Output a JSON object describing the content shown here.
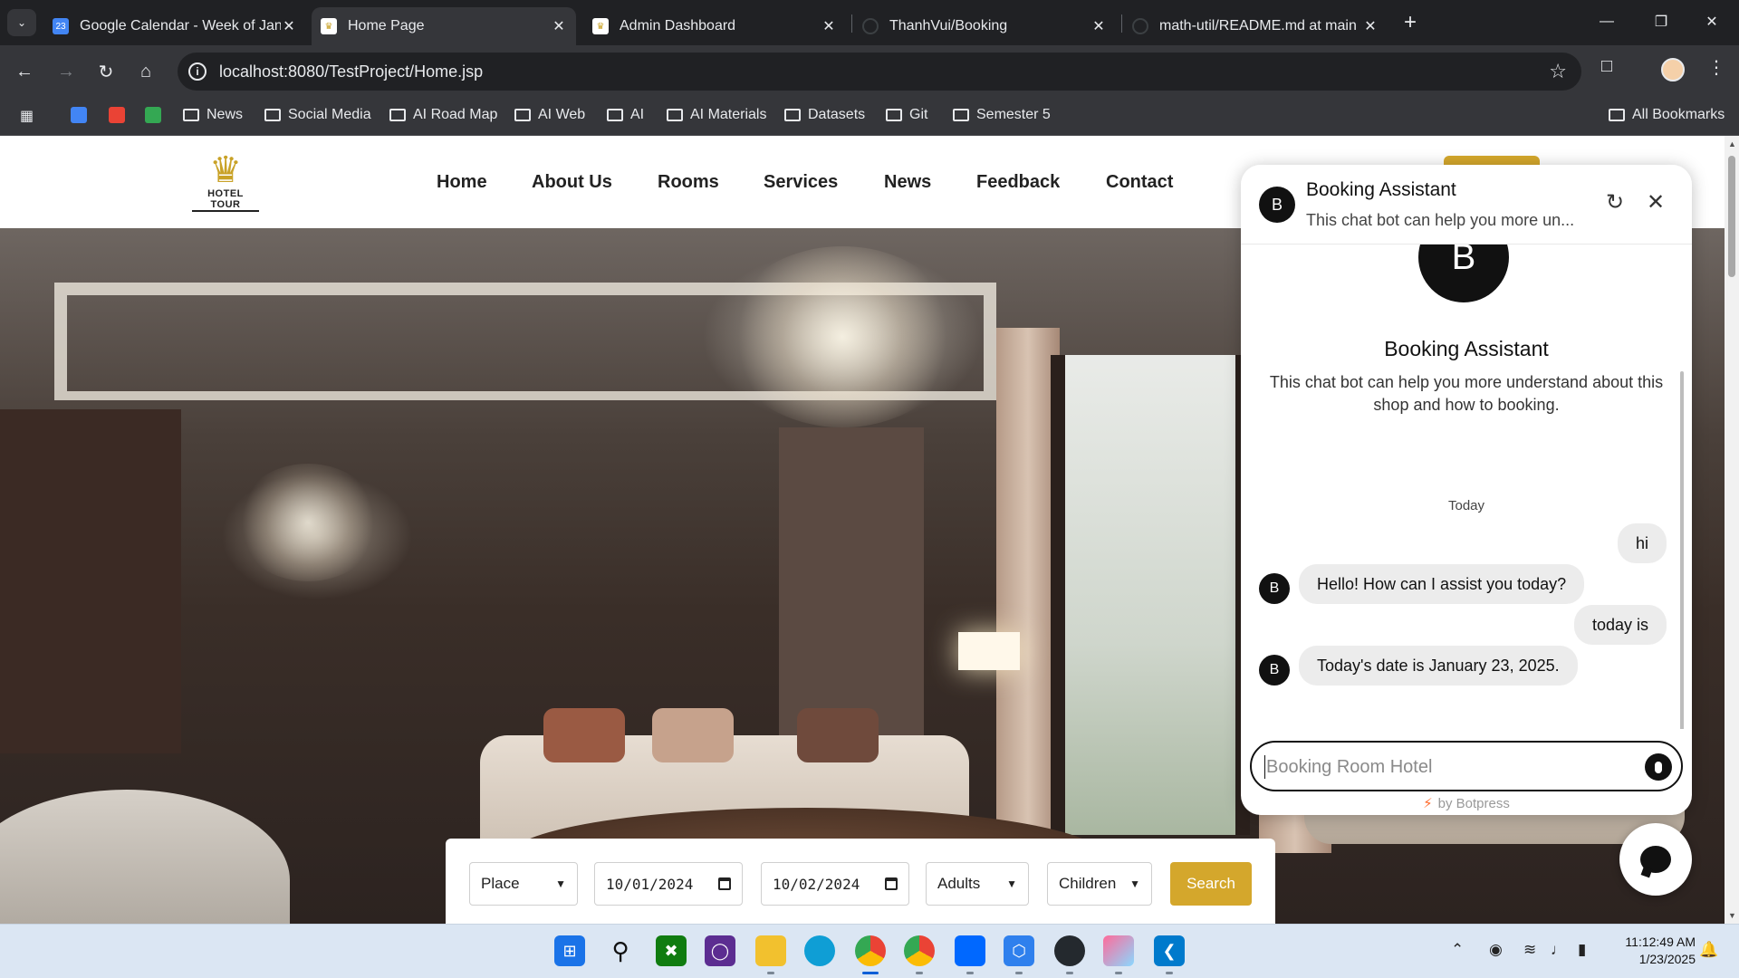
{
  "browser": {
    "tabs": [
      {
        "title": "Google Calendar - Week of Jan",
        "favicon": "calendar-icon",
        "active": false
      },
      {
        "title": "Home Page",
        "favicon": "hotel-crown-icon",
        "active": true
      },
      {
        "title": "Admin Dashboard",
        "favicon": "hotel-crown-icon",
        "active": false
      },
      {
        "title": "ThanhVui/Booking",
        "favicon": "github-icon",
        "active": false
      },
      {
        "title": "math-util/README.md at main",
        "favicon": "github-icon",
        "active": false
      }
    ],
    "url": "localhost:8080/TestProject/Home.jsp",
    "bookmarks": [
      {
        "label": "News"
      },
      {
        "label": "Social Media"
      },
      {
        "label": "AI Road Map"
      },
      {
        "label": "AI Web"
      },
      {
        "label": "AI"
      },
      {
        "label": "AI Materials"
      },
      {
        "label": "Datasets"
      },
      {
        "label": "Git"
      },
      {
        "label": "Semester 5"
      }
    ],
    "all_bookmarks": "All Bookmarks"
  },
  "site": {
    "logo_text": "HOTEL TOUR",
    "nav": [
      "Home",
      "About Us",
      "Rooms",
      "Services",
      "News",
      "Feedback",
      "Contact"
    ],
    "search": {
      "place": "Place",
      "checkin": "10/01/2024",
      "checkout": "10/02/2024",
      "adults": "Adults",
      "children": "Children",
      "button": "Search"
    }
  },
  "chat": {
    "header_title": "Booking Assistant",
    "header_subtitle": "This chat bot can help you more un...",
    "avatar_letter": "B",
    "bot_name": "Booking Assistant",
    "bot_description": "This chat bot can help you more understand about this shop and how to booking.",
    "day_label": "Today",
    "messages": [
      {
        "from": "user",
        "text": "hi"
      },
      {
        "from": "bot",
        "text": "Hello! How can I assist you today?"
      },
      {
        "from": "user",
        "text": "today is"
      },
      {
        "from": "bot",
        "text": "Today's date is January 23, 2025."
      }
    ],
    "input_placeholder": "Booking Room Hotel",
    "powered_by": "by Botpress"
  },
  "taskbar": {
    "time": "11:12:49 AM",
    "date": "1/23/2025",
    "apps": [
      "windows-start-icon",
      "search-icon",
      "xbox-icon",
      "terminal-icon",
      "file-explorer-icon",
      "edge-icon",
      "chrome-icon",
      "chrome-profile-icon",
      "zalo-icon",
      "hex-app-icon",
      "github-desktop-icon",
      "gem-app-icon",
      "vscode-icon"
    ]
  },
  "colors": {
    "accent_gold": "#d4a72c",
    "chrome_dark": "#202124",
    "chrome_toolbar": "#35363a"
  }
}
